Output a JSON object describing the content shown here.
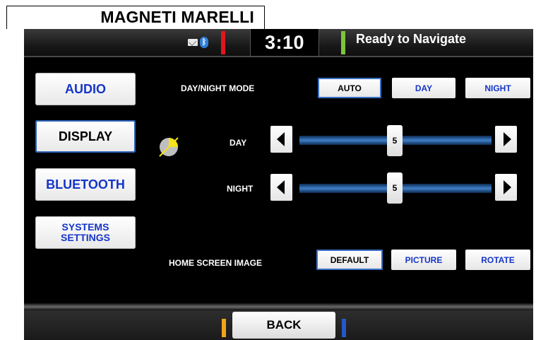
{
  "brand": {
    "label": "MAGNETI MARELLI"
  },
  "topbar": {
    "time": "3:10",
    "status": "Ready to Navigate",
    "icons": [
      "message-icon",
      "bluetooth-icon"
    ],
    "colors": {
      "left_indicator": "#e0161d",
      "right_indicator": "#7ec33b"
    }
  },
  "menu": {
    "items": [
      {
        "label": "AUDIO",
        "selected": false
      },
      {
        "label": "DISPLAY",
        "selected": true
      },
      {
        "label": "BLUETOOTH",
        "selected": false
      },
      {
        "label": "SYSTEMS\nSETTINGS",
        "selected": false
      }
    ]
  },
  "mode": {
    "label": "DAY/NIGHT MODE",
    "options": [
      {
        "label": "AUTO",
        "selected": true
      },
      {
        "label": "DAY",
        "selected": false
      },
      {
        "label": "NIGHT",
        "selected": false
      }
    ]
  },
  "brightness": {
    "day": {
      "label": "DAY",
      "value": "5"
    },
    "night": {
      "label": "NIGHT",
      "value": "5"
    }
  },
  "home_image": {
    "label": "HOME SCREEN IMAGE",
    "options": [
      {
        "label": "DEFAULT",
        "selected": true
      },
      {
        "label": "PICTURE",
        "selected": false
      },
      {
        "label": "ROTATE",
        "selected": false
      }
    ]
  },
  "bottombar": {
    "back_label": "BACK",
    "colors": {
      "left_indicator": "#f2a31b",
      "right_indicator": "#2458c8"
    }
  }
}
